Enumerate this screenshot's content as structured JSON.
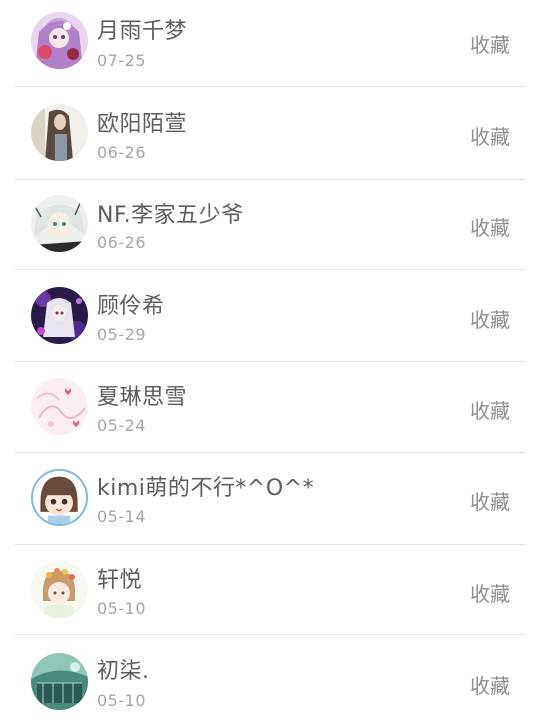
{
  "items": [
    {
      "name": "月雨千梦",
      "date": "07-25",
      "action": "收藏",
      "avatar_icon": "anime-girl-pink-avatar-icon"
    },
    {
      "name": "欧阳陌萱",
      "date": "06-26",
      "action": "收藏",
      "avatar_icon": "long-hair-girl-photo-avatar-icon"
    },
    {
      "name": "NF.李家五少爷",
      "date": "06-26",
      "action": "收藏",
      "avatar_icon": "anime-boy-sketch-avatar-icon"
    },
    {
      "name": "顾伶希",
      "date": "05-29",
      "action": "收藏",
      "avatar_icon": "anime-girl-purple-avatar-icon"
    },
    {
      "name": "夏琳思雪",
      "date": "05-24",
      "action": "收藏",
      "avatar_icon": "pink-pastel-drawing-avatar-icon"
    },
    {
      "name": "kimi萌的不行*^O^*",
      "date": "05-14",
      "action": "收藏",
      "avatar_icon": "chibi-girl-avatar-icon"
    },
    {
      "name": "轩悦",
      "date": "05-10",
      "action": "收藏",
      "avatar_icon": "flower-crown-girl-avatar-icon"
    },
    {
      "name": "初柒.",
      "date": "05-10",
      "action": "收藏",
      "avatar_icon": "teal-scenery-avatar-icon"
    }
  ]
}
